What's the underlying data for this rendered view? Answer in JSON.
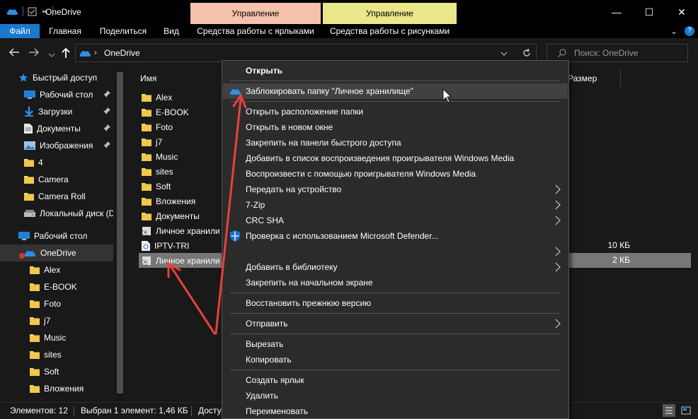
{
  "window": {
    "title": "OneDrive",
    "controls": {
      "minimize": "—",
      "maximize": "☐",
      "close": "✕"
    }
  },
  "contextual_tabs": {
    "shortcut_group": "Управление",
    "picture_group": "Управление"
  },
  "ribbon": {
    "tabs": [
      "Файл",
      "Главная",
      "Поделиться",
      "Вид",
      "Средства работы с ярлыками",
      "Средства работы с рисунками"
    ],
    "collapse_glyph": "⌄",
    "help_glyph": "?"
  },
  "address": {
    "path": "OneDrive",
    "search_placeholder": "Поиск: OneDrive"
  },
  "nav_pane": [
    {
      "label": "Быстрый доступ",
      "icon": "star-icon",
      "level": 0,
      "pinned": false
    },
    {
      "label": "Рабочий стол",
      "icon": "desktop-icon",
      "level": 1,
      "pinned": true
    },
    {
      "label": "Загрузки",
      "icon": "download-icon",
      "level": 1,
      "pinned": true
    },
    {
      "label": "Документы",
      "icon": "document-icon",
      "level": 1,
      "pinned": true
    },
    {
      "label": "Изображения",
      "icon": "pictures-icon",
      "level": 1,
      "pinned": true
    },
    {
      "label": "4",
      "icon": "folder-icon",
      "level": 1,
      "pinned": false
    },
    {
      "label": "Camera",
      "icon": "folder-icon",
      "level": 1,
      "pinned": false
    },
    {
      "label": "Camera Roll",
      "icon": "folder-icon",
      "level": 1,
      "pinned": false
    },
    {
      "label": "Локальный диск (D",
      "icon": "drive-icon",
      "level": 1,
      "pinned": false
    },
    {
      "label": "Рабочий стол",
      "icon": "desktop-icon",
      "level": 0,
      "pinned": false
    },
    {
      "label": "OneDrive",
      "icon": "onedrive-icon",
      "level": 0,
      "pinned": false,
      "selected": true
    },
    {
      "label": "Alex",
      "icon": "folder-icon",
      "level": 2,
      "pinned": false
    },
    {
      "label": "E-BOOK",
      "icon": "folder-icon",
      "level": 2,
      "pinned": false
    },
    {
      "label": "Foto",
      "icon": "folder-icon",
      "level": 2,
      "pinned": false
    },
    {
      "label": "j7",
      "icon": "folder-icon",
      "level": 2,
      "pinned": false
    },
    {
      "label": "Music",
      "icon": "folder-icon",
      "level": 2,
      "pinned": false
    },
    {
      "label": "sites",
      "icon": "folder-icon",
      "level": 2,
      "pinned": false
    },
    {
      "label": "Soft",
      "icon": "folder-icon",
      "level": 2,
      "pinned": false
    },
    {
      "label": "Вложения",
      "icon": "folder-icon",
      "level": 2,
      "pinned": false
    }
  ],
  "columns": {
    "name": "Имя",
    "size": "Размер"
  },
  "files": [
    {
      "name": "Alex",
      "icon": "folder-icon",
      "size": ""
    },
    {
      "name": "E-BOOK",
      "icon": "folder-icon",
      "size": ""
    },
    {
      "name": "Foto",
      "icon": "folder-icon",
      "size": ""
    },
    {
      "name": "j7",
      "icon": "folder-icon",
      "size": ""
    },
    {
      "name": "Music",
      "icon": "folder-icon",
      "size": ""
    },
    {
      "name": "sites",
      "icon": "folder-icon",
      "size": ""
    },
    {
      "name": "Soft",
      "icon": "folder-icon",
      "size": ""
    },
    {
      "name": "Вложения",
      "icon": "folder-icon",
      "size": ""
    },
    {
      "name": "Документы",
      "icon": "folder-icon",
      "size": ""
    },
    {
      "name": "Личное хранили",
      "icon": "shortcut-icon",
      "size": ""
    },
    {
      "name": "IPTV-TRI",
      "icon": "file-icon",
      "size": "10 КБ"
    },
    {
      "name": "Личное хранили",
      "icon": "shortcut-icon",
      "size": "2 КБ",
      "selected": true
    }
  ],
  "status": {
    "count": "Элементов: 12",
    "selection": "Выбран 1 элемент: 1,46 КБ",
    "availability": "Досту"
  },
  "context_menu": [
    {
      "label": "Открыть",
      "bold": true
    },
    {
      "sep": true
    },
    {
      "label": "Заблокировать папку \"Личное хранилище\"",
      "icon": "onedrive-icon",
      "hover": true
    },
    {
      "sep": true
    },
    {
      "label": "Открыть расположение папки"
    },
    {
      "label": "Открыть в новом окне"
    },
    {
      "label": "Закрепить на панели быстрого доступа"
    },
    {
      "label": "Добавить в список воспроизведения проигрывателя Windows Media"
    },
    {
      "label": "Воспроизвести с помощью проигрывателя Windows Media"
    },
    {
      "label": "Передать на устройство",
      "submenu": true
    },
    {
      "label": "7-Zip",
      "submenu": true
    },
    {
      "label": "CRC SHA",
      "submenu": true
    },
    {
      "label": "Проверка с использованием Microsoft Defender...",
      "icon": "defender-shield-icon"
    },
    {
      "label": "",
      "submenu": true
    },
    {
      "label": "Добавить в библиотеку",
      "submenu": true
    },
    {
      "label": "Закрепить на начальном экране"
    },
    {
      "sep": true
    },
    {
      "label": "Восстановить прежнюю версию"
    },
    {
      "sep": true
    },
    {
      "label": "Отправить",
      "submenu": true
    },
    {
      "sep": true
    },
    {
      "label": "Вырезать"
    },
    {
      "label": "Копировать"
    },
    {
      "sep": true
    },
    {
      "label": "Создать ярлык"
    },
    {
      "label": "Удалить"
    },
    {
      "label": "Переименовать"
    }
  ],
  "colors": {
    "accent": "#1979ca",
    "tab_shortcut": "#f6c1ad",
    "tab_picture": "#e9e88a",
    "annotation": "#e8413a",
    "folder": "#f7d774"
  }
}
